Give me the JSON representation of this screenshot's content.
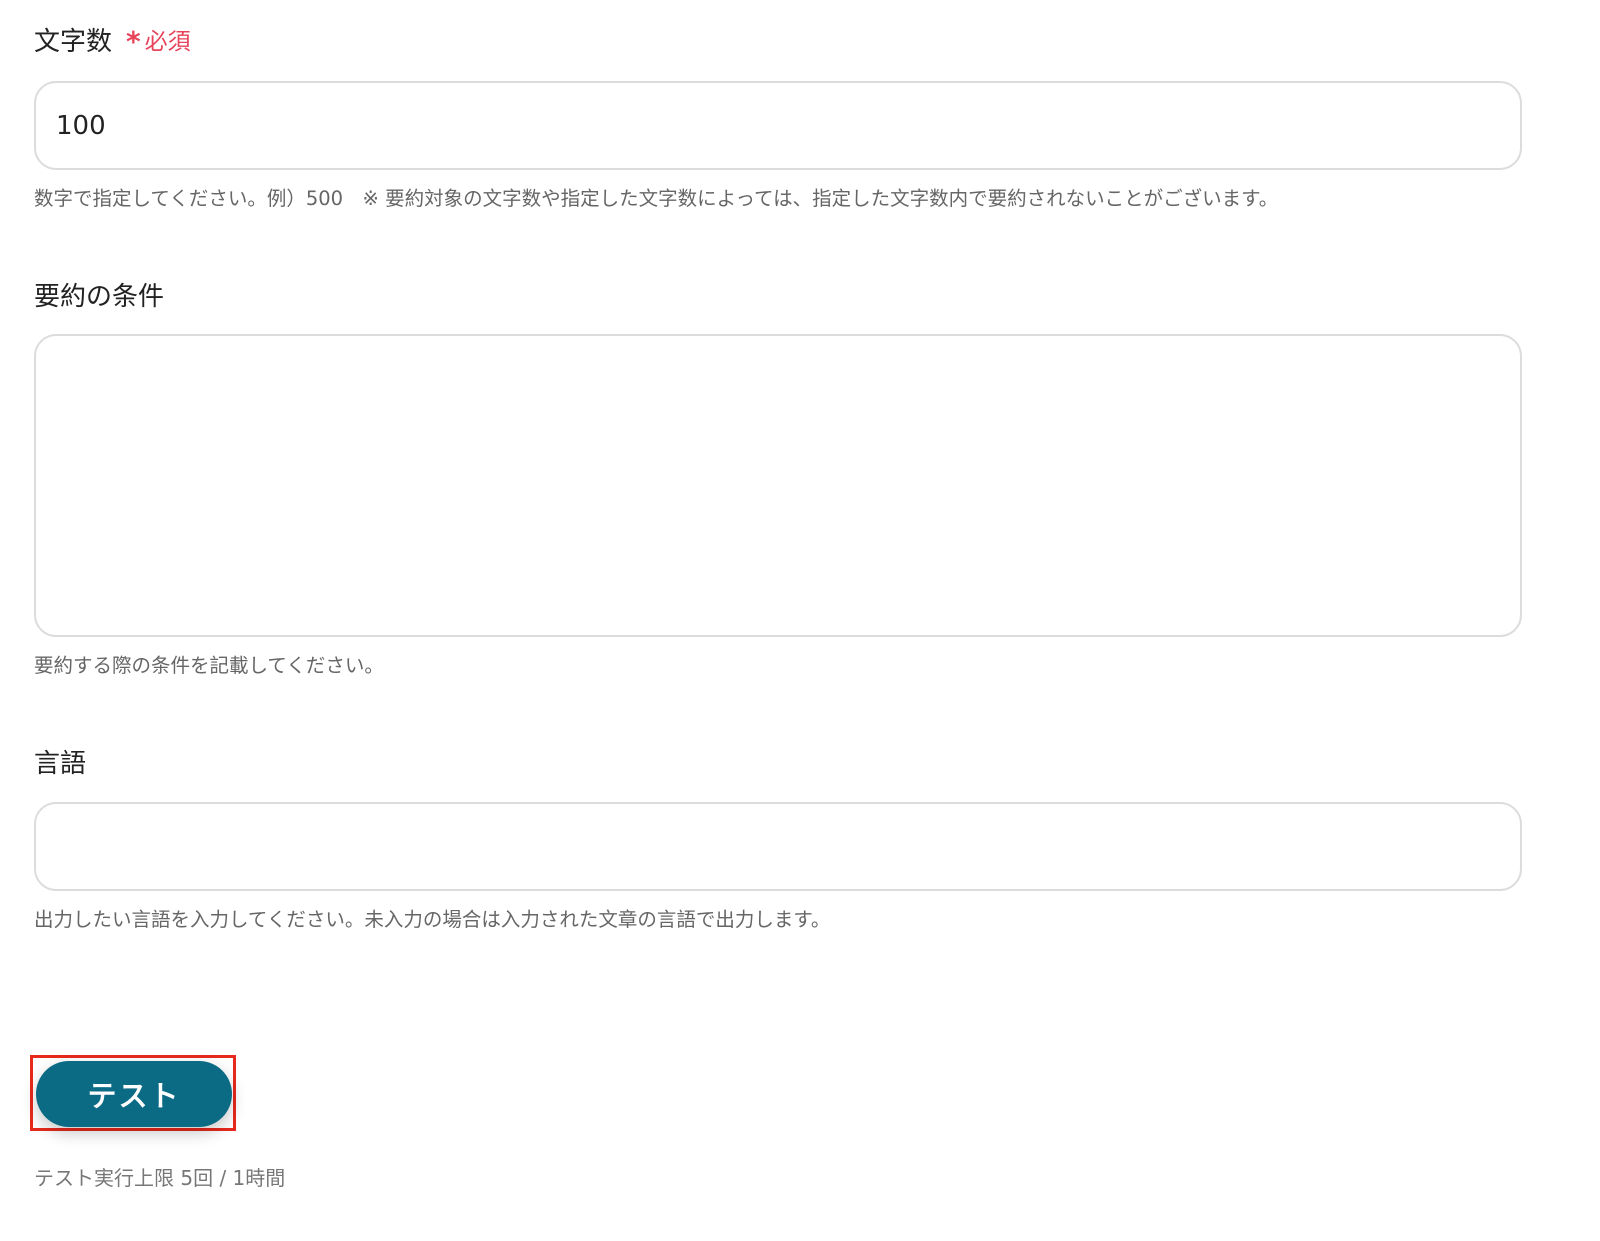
{
  "fields": {
    "char_count": {
      "label": "文字数",
      "required_label": "必須",
      "value": "100",
      "helper": "数字で指定してください。例）500　※ 要約対象の文字数や指定した文字数によっては、指定した文字数内で要約されないことがございます。"
    },
    "conditions": {
      "label": "要約の条件",
      "value": "",
      "helper": "要約する際の条件を記載してください。"
    },
    "language": {
      "label": "言語",
      "value": "",
      "helper": "出力したい言語を入力してください。未入力の場合は入力された文章の言語で出力します。"
    }
  },
  "test_button": {
    "label": "テスト"
  },
  "limit_text": "テスト実行上限 5回 / 1時間",
  "colors": {
    "required": "#e8435a",
    "button": "#0b6b85",
    "highlight": "#e8291d"
  }
}
